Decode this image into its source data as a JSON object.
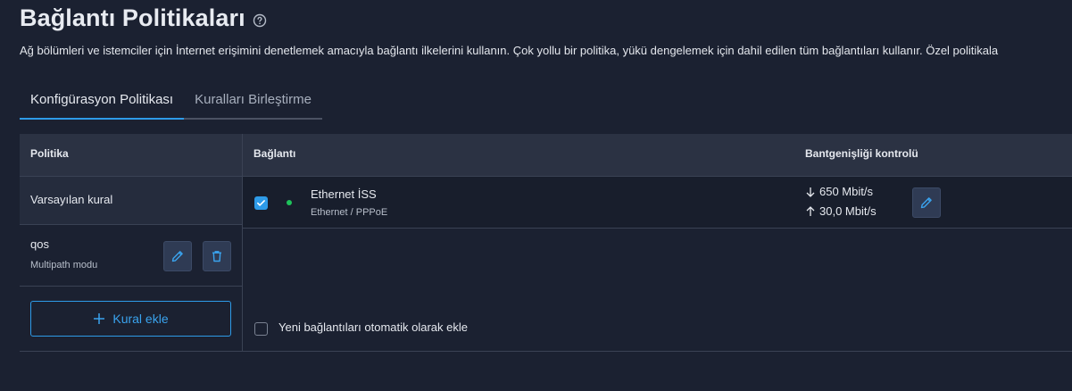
{
  "header": {
    "title": "Bağlantı Politikaları",
    "description": "Ağ bölümleri ve istemciler için İnternet erişimini denetlemek amacıyla bağlantı ilkelerini kullanın. Çok yollu bir politika, yükü dengelemek için dahil edilen tüm bağlantıları kullanır. Özel politikala"
  },
  "tabs": [
    {
      "label": "Konfigürasyon Politikası",
      "active": true
    },
    {
      "label": "Kuralları Birleştirme",
      "active": false
    }
  ],
  "table": {
    "headers": {
      "policy": "Politika",
      "connection": "Bağlantı",
      "bandwidth": "Bantgenişliği kontrolü"
    },
    "rules": [
      {
        "name": "Varsayılan kural"
      },
      {
        "name": "qos",
        "subtitle": "Multipath modu"
      }
    ],
    "add_rule_label": "Kural ekle",
    "connection": {
      "name": "Ethernet İSS",
      "type": "Ethernet / PPPoE",
      "checked": true,
      "status_color": "#1ec35a",
      "download": "650 Mbit/s",
      "upload": "30,0 Mbit/s"
    },
    "auto_add_label": "Yeni bağlantıları otomatik olarak ekle",
    "auto_add_checked": false
  },
  "colors": {
    "accent": "#2e9be8",
    "background": "#1b2131",
    "header_bg": "#2b3243"
  },
  "icons": {
    "help": "help-circle-icon",
    "edit": "pencil-icon",
    "delete": "trash-icon",
    "add": "plus-icon",
    "download": "arrow-down-icon",
    "upload": "arrow-up-icon",
    "check": "check-icon"
  }
}
